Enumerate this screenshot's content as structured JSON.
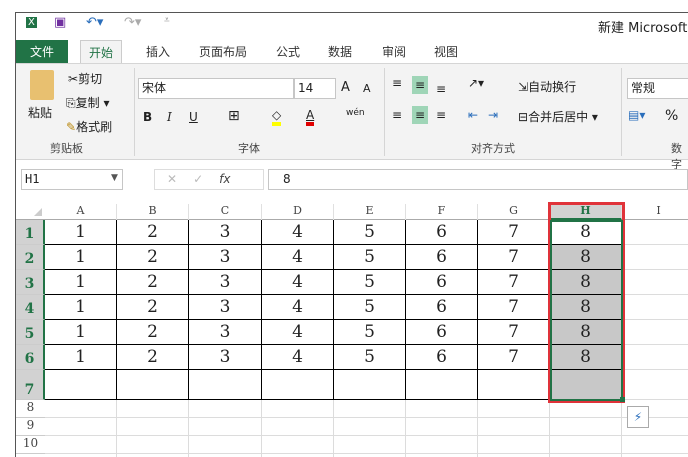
{
  "title": "新建 Microsoft E",
  "tabs": [
    "文件",
    "开始",
    "插入",
    "页面布局",
    "公式",
    "数据",
    "审阅",
    "视图"
  ],
  "clipboard": {
    "paste": "粘贴",
    "cut": "剪切",
    "copy": "复制",
    "format_painter": "格式刷",
    "group": "剪贴板"
  },
  "font": {
    "name": "宋体",
    "size": "14",
    "bold": "B",
    "italic": "I",
    "underline": "U",
    "group": "字体",
    "grow": "A",
    "shrink": "A",
    "font_color": "A",
    "phonetic": "wén"
  },
  "alignment": {
    "wrap": "自动换行",
    "merge": "合并后居中",
    "group": "对齐方式"
  },
  "number": {
    "format": "常规",
    "percent": "%",
    "group": "数字"
  },
  "formula_bar": {
    "name_box": "H1",
    "cancel": "✕",
    "enter": "✓",
    "fx": "fx",
    "value": "8"
  },
  "columns": [
    "A",
    "B",
    "C",
    "D",
    "E",
    "F",
    "G",
    "H",
    "I"
  ],
  "rows": [
    "1",
    "2",
    "3",
    "4",
    "5",
    "6",
    "7",
    "8",
    "9",
    "10"
  ],
  "cells": [
    [
      "1",
      "2",
      "3",
      "4",
      "5",
      "6",
      "7",
      "8"
    ],
    [
      "1",
      "2",
      "3",
      "4",
      "5",
      "6",
      "7",
      "8"
    ],
    [
      "1",
      "2",
      "3",
      "4",
      "5",
      "6",
      "7",
      "8"
    ],
    [
      "1",
      "2",
      "3",
      "4",
      "5",
      "6",
      "7",
      "8"
    ],
    [
      "1",
      "2",
      "3",
      "4",
      "5",
      "6",
      "7",
      "8"
    ],
    [
      "1",
      "2",
      "3",
      "4",
      "5",
      "6",
      "7",
      "8"
    ],
    [
      "",
      "",
      "",
      "",
      "",
      "",
      "",
      ""
    ]
  ],
  "colors": {
    "accent": "#217346",
    "selection": "#c6c6c6",
    "highlight_border": "#e0333a"
  }
}
